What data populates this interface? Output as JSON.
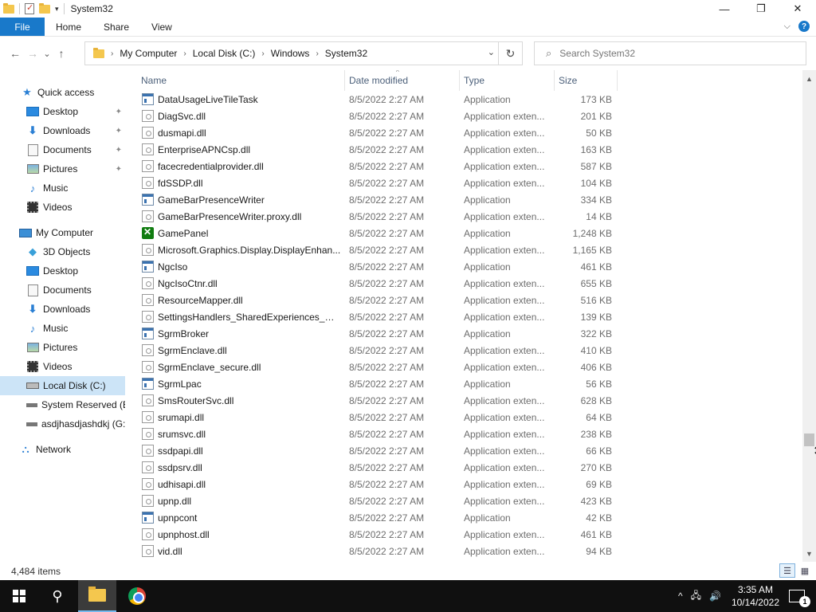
{
  "window": {
    "title": "System32",
    "controls": {
      "minimize": "—",
      "maximize": "❐",
      "close": "✕"
    }
  },
  "ribbon": {
    "tabs": [
      "File",
      "Home",
      "Share",
      "View"
    ],
    "expand_glyph": "⌵",
    "help_glyph": "?"
  },
  "nav": {
    "back": "←",
    "forward": "→",
    "recent": "⌄",
    "up": "↑"
  },
  "address": {
    "crumbs": [
      "My Computer",
      "Local Disk (C:)",
      "Windows",
      "System32"
    ],
    "separator": "›",
    "dropdown": "⌄",
    "refresh": "↻"
  },
  "search": {
    "placeholder": "Search System32",
    "icon": "search-icon"
  },
  "sidebar": {
    "quick_access": "Quick access",
    "quick_items": [
      {
        "label": "Desktop",
        "icon": "desktop-icon",
        "pinned": true
      },
      {
        "label": "Downloads",
        "icon": "downloads-icon",
        "pinned": true
      },
      {
        "label": "Documents",
        "icon": "documents-icon",
        "pinned": true
      },
      {
        "label": "Pictures",
        "icon": "pictures-icon",
        "pinned": true
      },
      {
        "label": "Music",
        "icon": "music-icon",
        "pinned": false
      },
      {
        "label": "Videos",
        "icon": "videos-icon",
        "pinned": false
      }
    ],
    "this_pc": "My Computer",
    "pc_items": [
      {
        "label": "3D Objects",
        "icon": "3d-objects-icon"
      },
      {
        "label": "Desktop",
        "icon": "desktop-icon"
      },
      {
        "label": "Documents",
        "icon": "documents-icon"
      },
      {
        "label": "Downloads",
        "icon": "downloads-icon"
      },
      {
        "label": "Music",
        "icon": "music-icon"
      },
      {
        "label": "Pictures",
        "icon": "pictures-icon"
      },
      {
        "label": "Videos",
        "icon": "videos-icon"
      },
      {
        "label": "Local Disk (C:)",
        "icon": "local-disk-icon",
        "selected": true
      },
      {
        "label": "System Reserved (E:",
        "icon": "drive-icon"
      },
      {
        "label": "asdjhasdjashdkj (G:)",
        "icon": "drive-icon"
      }
    ],
    "network": "Network",
    "pin_glyph": "📌"
  },
  "columns": {
    "name": "Name",
    "date": "Date modified",
    "type": "Type",
    "size": "Size",
    "sort_glyph": "^"
  },
  "files": [
    {
      "name": "DataUsageLiveTileTask",
      "date": "8/5/2022 2:27 AM",
      "type": "Application",
      "size": "173 KB",
      "kind": "app"
    },
    {
      "name": "DiagSvc.dll",
      "date": "8/5/2022 2:27 AM",
      "type": "Application exten...",
      "size": "201 KB",
      "kind": "dll"
    },
    {
      "name": "dusmapi.dll",
      "date": "8/5/2022 2:27 AM",
      "type": "Application exten...",
      "size": "50 KB",
      "kind": "dll"
    },
    {
      "name": "EnterpriseAPNCsp.dll",
      "date": "8/5/2022 2:27 AM",
      "type": "Application exten...",
      "size": "163 KB",
      "kind": "dll"
    },
    {
      "name": "facecredentialprovider.dll",
      "date": "8/5/2022 2:27 AM",
      "type": "Application exten...",
      "size": "587 KB",
      "kind": "dll"
    },
    {
      "name": "fdSSDP.dll",
      "date": "8/5/2022 2:27 AM",
      "type": "Application exten...",
      "size": "104 KB",
      "kind": "dll"
    },
    {
      "name": "GameBarPresenceWriter",
      "date": "8/5/2022 2:27 AM",
      "type": "Application",
      "size": "334 KB",
      "kind": "app"
    },
    {
      "name": "GameBarPresenceWriter.proxy.dll",
      "date": "8/5/2022 2:27 AM",
      "type": "Application exten...",
      "size": "14 KB",
      "kind": "dll"
    },
    {
      "name": "GamePanel",
      "date": "8/5/2022 2:27 AM",
      "type": "Application",
      "size": "1,248 KB",
      "kind": "xbox"
    },
    {
      "name": "Microsoft.Graphics.Display.DisplayEnhan...",
      "date": "8/5/2022 2:27 AM",
      "type": "Application exten...",
      "size": "1,165 KB",
      "kind": "dll"
    },
    {
      "name": "NgcIso",
      "date": "8/5/2022 2:27 AM",
      "type": "Application",
      "size": "461 KB",
      "kind": "app"
    },
    {
      "name": "NgcIsoCtnr.dll",
      "date": "8/5/2022 2:27 AM",
      "type": "Application exten...",
      "size": "655 KB",
      "kind": "dll"
    },
    {
      "name": "ResourceMapper.dll",
      "date": "8/5/2022 2:27 AM",
      "type": "Application exten...",
      "size": "516 KB",
      "kind": "dll"
    },
    {
      "name": "SettingsHandlers_SharedExperiences_Ro...",
      "date": "8/5/2022 2:27 AM",
      "type": "Application exten...",
      "size": "139 KB",
      "kind": "dll"
    },
    {
      "name": "SgrmBroker",
      "date": "8/5/2022 2:27 AM",
      "type": "Application",
      "size": "322 KB",
      "kind": "app"
    },
    {
      "name": "SgrmEnclave.dll",
      "date": "8/5/2022 2:27 AM",
      "type": "Application exten...",
      "size": "410 KB",
      "kind": "dll"
    },
    {
      "name": "SgrmEnclave_secure.dll",
      "date": "8/5/2022 2:27 AM",
      "type": "Application exten...",
      "size": "406 KB",
      "kind": "dll"
    },
    {
      "name": "SgrmLpac",
      "date": "8/5/2022 2:27 AM",
      "type": "Application",
      "size": "56 KB",
      "kind": "app"
    },
    {
      "name": "SmsRouterSvc.dll",
      "date": "8/5/2022 2:27 AM",
      "type": "Application exten...",
      "size": "628 KB",
      "kind": "dll"
    },
    {
      "name": "srumapi.dll",
      "date": "8/5/2022 2:27 AM",
      "type": "Application exten...",
      "size": "64 KB",
      "kind": "dll"
    },
    {
      "name": "srumsvc.dll",
      "date": "8/5/2022 2:27 AM",
      "type": "Application exten...",
      "size": "238 KB",
      "kind": "dll"
    },
    {
      "name": "ssdpapi.dll",
      "date": "8/5/2022 2:27 AM",
      "type": "Application exten...",
      "size": "66 KB",
      "kind": "dll"
    },
    {
      "name": "ssdpsrv.dll",
      "date": "8/5/2022 2:27 AM",
      "type": "Application exten...",
      "size": "270 KB",
      "kind": "dll"
    },
    {
      "name": "udhisapi.dll",
      "date": "8/5/2022 2:27 AM",
      "type": "Application exten...",
      "size": "69 KB",
      "kind": "dll"
    },
    {
      "name": "upnp.dll",
      "date": "8/5/2022 2:27 AM",
      "type": "Application exten...",
      "size": "423 KB",
      "kind": "dll"
    },
    {
      "name": "upnpcont",
      "date": "8/5/2022 2:27 AM",
      "type": "Application",
      "size": "42 KB",
      "kind": "app"
    },
    {
      "name": "upnphost.dll",
      "date": "8/5/2022 2:27 AM",
      "type": "Application exten...",
      "size": "461 KB",
      "kind": "dll"
    },
    {
      "name": "vid.dll",
      "date": "8/5/2022 2:27 AM",
      "type": "Application exten...",
      "size": "94 KB",
      "kind": "dll"
    }
  ],
  "scrollbar": {
    "up": "▲",
    "down": "▼"
  },
  "status": {
    "item_count": "4,484 items"
  },
  "view_buttons": {
    "details": "☰",
    "tiles": "▦"
  },
  "taskbar": {
    "clock_time": "3:35 AM",
    "clock_date": "10/14/2022",
    "tray_chevron": "^",
    "network_icon": "🖧",
    "volume_icon": "🔊",
    "notification_count": "1",
    "search_glyph": "⚲"
  },
  "colors": {
    "accent": "#1979ca",
    "selected_bg": "#cce4f7",
    "header_text": "#4c607a",
    "taskbar_bg": "#101010"
  }
}
